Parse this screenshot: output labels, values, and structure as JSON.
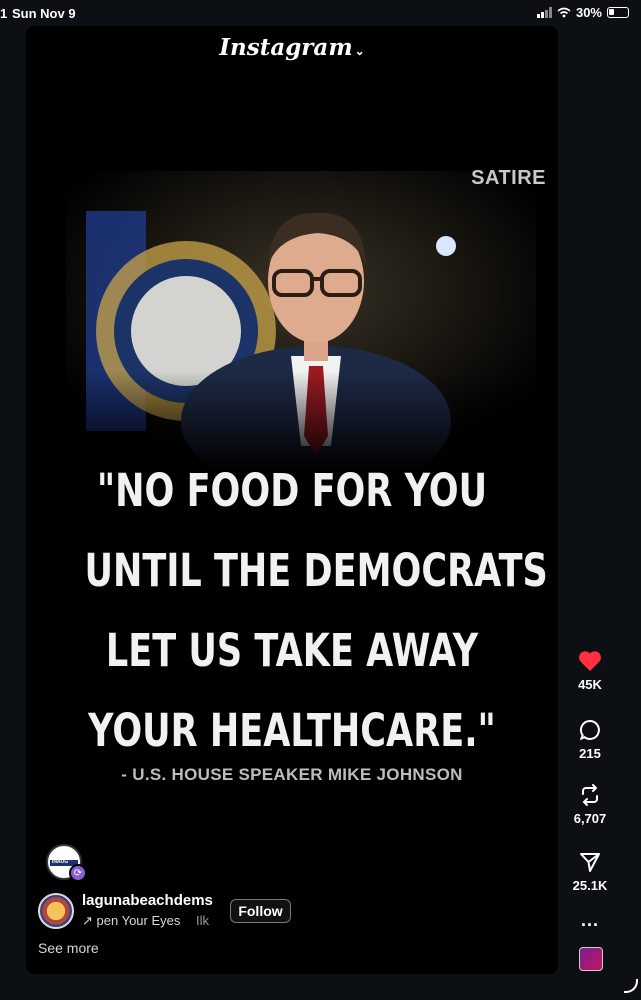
{
  "status_bar": {
    "time_fragment": "1",
    "date": "Sun Nov 9",
    "battery": "30%"
  },
  "post": {
    "header": "Instagram",
    "satire_label": "SATIRE",
    "quote_lines": [
      "\"NO FOOD FOR YOU",
      "UNTIL THE DEMOCRATS",
      "LET US TAKE AWAY",
      "YOUR HEALTHCARE.\""
    ],
    "attribution": "- U.S. HOUSE SPEAKER MIKE JOHNSON",
    "collab_avatar_text": "INAUG",
    "username": "lagunabeachdems",
    "song_arrow": "↗",
    "song": "pen Your Eyes",
    "song_artist": "Ilk",
    "follow_label": "Follow",
    "see_more": "See more"
  },
  "actions": {
    "likes": "45K",
    "comments": "215",
    "reposts": "6,707",
    "shares": "25.1K",
    "more": "..."
  },
  "colors": {
    "like": "#ff3040",
    "background": "#000000",
    "page": "#0c0f14"
  }
}
